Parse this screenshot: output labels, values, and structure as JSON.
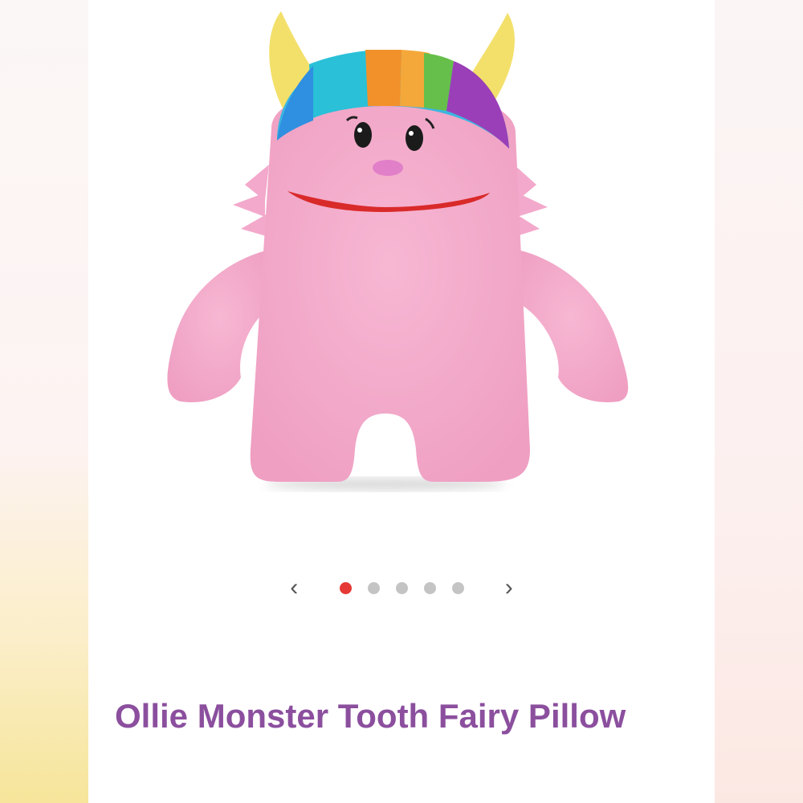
{
  "product": {
    "title": "Ollie Monster Tooth Fairy Pillow",
    "image_icon": "plush-monster-image"
  },
  "carousel": {
    "prev_icon": "chevron-left-icon",
    "next_icon": "chevron-right-icon",
    "dots": 5,
    "active_index": 0,
    "active_color": "#e53935",
    "inactive_color": "#c4c4c4"
  },
  "colors": {
    "title": "#8b4f9e",
    "plush": "#f3a9cb"
  }
}
